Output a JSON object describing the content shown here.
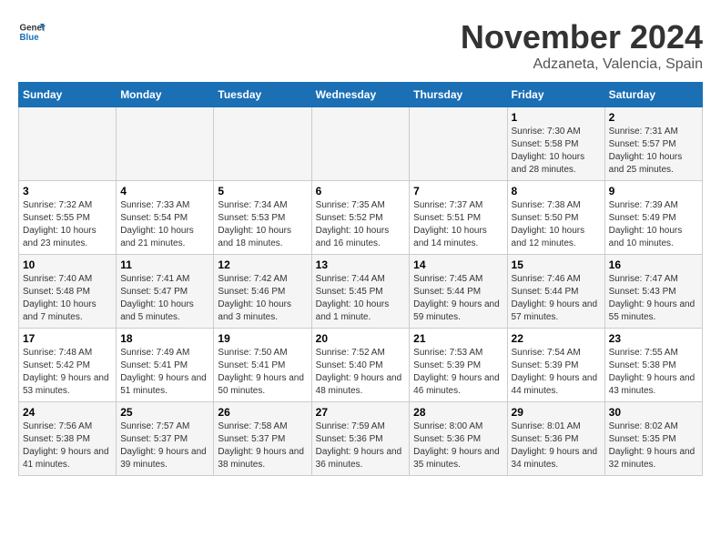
{
  "logo": {
    "line1": "General",
    "line2": "Blue"
  },
  "title": "November 2024",
  "location": "Adzaneta, Valencia, Spain",
  "weekdays": [
    "Sunday",
    "Monday",
    "Tuesday",
    "Wednesday",
    "Thursday",
    "Friday",
    "Saturday"
  ],
  "weeks": [
    [
      {
        "day": "",
        "info": ""
      },
      {
        "day": "",
        "info": ""
      },
      {
        "day": "",
        "info": ""
      },
      {
        "day": "",
        "info": ""
      },
      {
        "day": "",
        "info": ""
      },
      {
        "day": "1",
        "info": "Sunrise: 7:30 AM\nSunset: 5:58 PM\nDaylight: 10 hours and 28 minutes."
      },
      {
        "day": "2",
        "info": "Sunrise: 7:31 AM\nSunset: 5:57 PM\nDaylight: 10 hours and 25 minutes."
      }
    ],
    [
      {
        "day": "3",
        "info": "Sunrise: 7:32 AM\nSunset: 5:55 PM\nDaylight: 10 hours and 23 minutes."
      },
      {
        "day": "4",
        "info": "Sunrise: 7:33 AM\nSunset: 5:54 PM\nDaylight: 10 hours and 21 minutes."
      },
      {
        "day": "5",
        "info": "Sunrise: 7:34 AM\nSunset: 5:53 PM\nDaylight: 10 hours and 18 minutes."
      },
      {
        "day": "6",
        "info": "Sunrise: 7:35 AM\nSunset: 5:52 PM\nDaylight: 10 hours and 16 minutes."
      },
      {
        "day": "7",
        "info": "Sunrise: 7:37 AM\nSunset: 5:51 PM\nDaylight: 10 hours and 14 minutes."
      },
      {
        "day": "8",
        "info": "Sunrise: 7:38 AM\nSunset: 5:50 PM\nDaylight: 10 hours and 12 minutes."
      },
      {
        "day": "9",
        "info": "Sunrise: 7:39 AM\nSunset: 5:49 PM\nDaylight: 10 hours and 10 minutes."
      }
    ],
    [
      {
        "day": "10",
        "info": "Sunrise: 7:40 AM\nSunset: 5:48 PM\nDaylight: 10 hours and 7 minutes."
      },
      {
        "day": "11",
        "info": "Sunrise: 7:41 AM\nSunset: 5:47 PM\nDaylight: 10 hours and 5 minutes."
      },
      {
        "day": "12",
        "info": "Sunrise: 7:42 AM\nSunset: 5:46 PM\nDaylight: 10 hours and 3 minutes."
      },
      {
        "day": "13",
        "info": "Sunrise: 7:44 AM\nSunset: 5:45 PM\nDaylight: 10 hours and 1 minute."
      },
      {
        "day": "14",
        "info": "Sunrise: 7:45 AM\nSunset: 5:44 PM\nDaylight: 9 hours and 59 minutes."
      },
      {
        "day": "15",
        "info": "Sunrise: 7:46 AM\nSunset: 5:44 PM\nDaylight: 9 hours and 57 minutes."
      },
      {
        "day": "16",
        "info": "Sunrise: 7:47 AM\nSunset: 5:43 PM\nDaylight: 9 hours and 55 minutes."
      }
    ],
    [
      {
        "day": "17",
        "info": "Sunrise: 7:48 AM\nSunset: 5:42 PM\nDaylight: 9 hours and 53 minutes."
      },
      {
        "day": "18",
        "info": "Sunrise: 7:49 AM\nSunset: 5:41 PM\nDaylight: 9 hours and 51 minutes."
      },
      {
        "day": "19",
        "info": "Sunrise: 7:50 AM\nSunset: 5:41 PM\nDaylight: 9 hours and 50 minutes."
      },
      {
        "day": "20",
        "info": "Sunrise: 7:52 AM\nSunset: 5:40 PM\nDaylight: 9 hours and 48 minutes."
      },
      {
        "day": "21",
        "info": "Sunrise: 7:53 AM\nSunset: 5:39 PM\nDaylight: 9 hours and 46 minutes."
      },
      {
        "day": "22",
        "info": "Sunrise: 7:54 AM\nSunset: 5:39 PM\nDaylight: 9 hours and 44 minutes."
      },
      {
        "day": "23",
        "info": "Sunrise: 7:55 AM\nSunset: 5:38 PM\nDaylight: 9 hours and 43 minutes."
      }
    ],
    [
      {
        "day": "24",
        "info": "Sunrise: 7:56 AM\nSunset: 5:38 PM\nDaylight: 9 hours and 41 minutes."
      },
      {
        "day": "25",
        "info": "Sunrise: 7:57 AM\nSunset: 5:37 PM\nDaylight: 9 hours and 39 minutes."
      },
      {
        "day": "26",
        "info": "Sunrise: 7:58 AM\nSunset: 5:37 PM\nDaylight: 9 hours and 38 minutes."
      },
      {
        "day": "27",
        "info": "Sunrise: 7:59 AM\nSunset: 5:36 PM\nDaylight: 9 hours and 36 minutes."
      },
      {
        "day": "28",
        "info": "Sunrise: 8:00 AM\nSunset: 5:36 PM\nDaylight: 9 hours and 35 minutes."
      },
      {
        "day": "29",
        "info": "Sunrise: 8:01 AM\nSunset: 5:36 PM\nDaylight: 9 hours and 34 minutes."
      },
      {
        "day": "30",
        "info": "Sunrise: 8:02 AM\nSunset: 5:35 PM\nDaylight: 9 hours and 32 minutes."
      }
    ]
  ]
}
